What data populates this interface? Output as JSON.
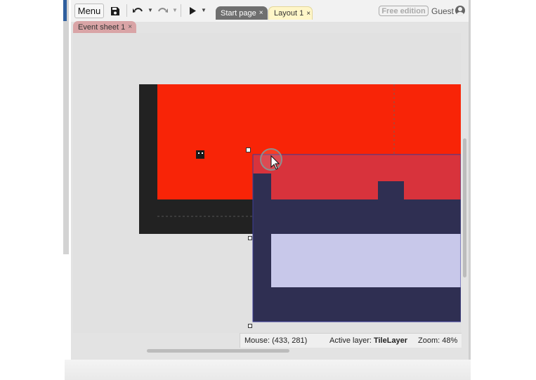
{
  "toolbar": {
    "menu_label": "Menu",
    "icons": [
      "save-icon",
      "undo-icon",
      "redo-icon",
      "play-icon"
    ]
  },
  "tabs": [
    {
      "label": "Start page",
      "close": "×",
      "active": false
    },
    {
      "label": "Layout 1",
      "close": "×",
      "active": true
    }
  ],
  "subtabs": [
    {
      "label": "Event sheet 1",
      "close": "×"
    }
  ],
  "header": {
    "badge": "Free edition",
    "user": "Guest"
  },
  "status": {
    "mouse": "Mouse: (433, 281)",
    "layer_prefix": "Active layer: ",
    "layer_name": "TileLayer",
    "zoom": "Zoom: 48%"
  },
  "colors": {
    "layout_background": "#f82407",
    "tilemap_fill": "#2f2f52",
    "tilemap_hole": "#c8c8ea",
    "tab_layout_bg": "#fff6c8",
    "subtab_bg": "#d9a4a6"
  }
}
